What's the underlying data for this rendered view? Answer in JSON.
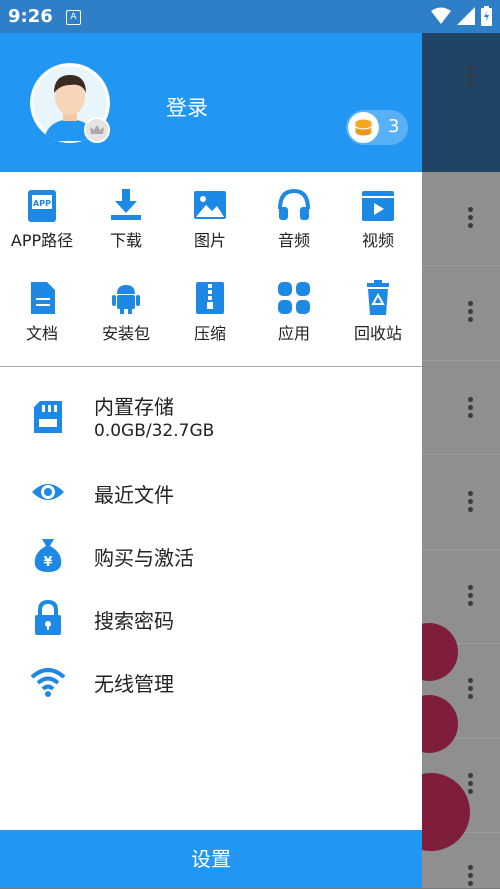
{
  "status_bar": {
    "time": "9:26",
    "notification_glyph": "A"
  },
  "drawer": {
    "login_label": "登录",
    "coin_count": "3",
    "grid": [
      {
        "label": "APP路径",
        "icon": "app-icon"
      },
      {
        "label": "下载",
        "icon": "download-icon"
      },
      {
        "label": "图片",
        "icon": "image-icon"
      },
      {
        "label": "音频",
        "icon": "headphones-icon"
      },
      {
        "label": "视频",
        "icon": "video-icon"
      },
      {
        "label": "文档",
        "icon": "document-icon"
      },
      {
        "label": "安装包",
        "icon": "android-icon"
      },
      {
        "label": "压缩",
        "icon": "zip-icon"
      },
      {
        "label": "应用",
        "icon": "apps-icon"
      },
      {
        "label": "回收站",
        "icon": "recycle-icon"
      }
    ],
    "menu": {
      "storage_label": "内置存储",
      "storage_value": "0.0GB/32.7GB",
      "recent_label": "最近文件",
      "purchase_label": "购买与激活",
      "password_label": "搜索密码",
      "wireless_label": "无线管理"
    },
    "settings_label": "设置"
  },
  "colors": {
    "accent": "#2196f3",
    "icon_blue": "#1e88e5",
    "fab": "#7f1e3b"
  }
}
